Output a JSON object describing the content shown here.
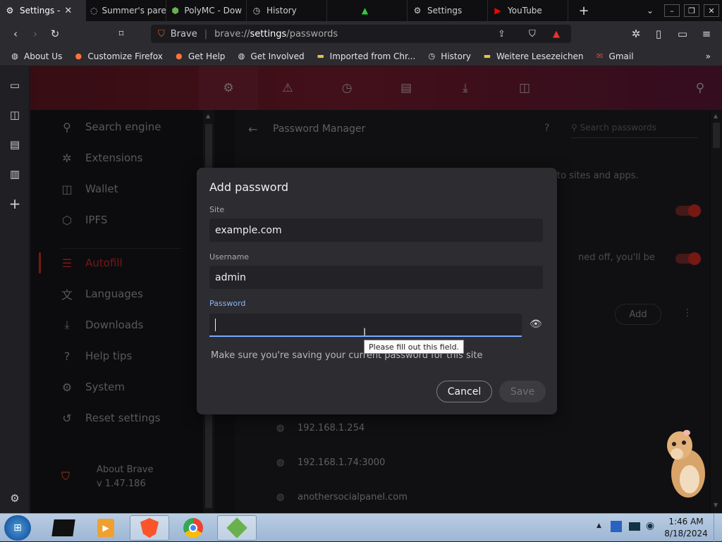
{
  "tabs": [
    {
      "label": "Settings - ",
      "icon": "gear-icon",
      "active": true
    },
    {
      "label": "Summer's pare",
      "icon": "page-icon",
      "active": false
    },
    {
      "label": "PolyMC - Dow",
      "icon": "polymc-icon",
      "active": false
    },
    {
      "label": "History",
      "icon": "history-icon",
      "active": false
    },
    {
      "label": "",
      "icon": "brave-leaf-icon",
      "active": false
    },
    {
      "label": "Settings",
      "icon": "gear-icon",
      "active": false
    },
    {
      "label": "YouTube",
      "icon": "youtube-icon",
      "active": false
    }
  ],
  "toolbar": {
    "site_name": "Brave",
    "url_prefix": "brave://",
    "url_bold": "settings",
    "url_suffix": "/passwords"
  },
  "bookmarks": [
    {
      "label": "About Us",
      "icon": "globe-icon"
    },
    {
      "label": "Customize Firefox",
      "icon": "firefox-icon"
    },
    {
      "label": "Get Help",
      "icon": "firefox-icon"
    },
    {
      "label": "Get Involved",
      "icon": "globe-icon"
    },
    {
      "label": "Imported from Chr...",
      "icon": "folder-icon"
    },
    {
      "label": "History",
      "icon": "history-icon"
    },
    {
      "label": "Weitere Lesezeichen",
      "icon": "folder-icon"
    },
    {
      "label": "Gmail",
      "icon": "gmail-icon"
    }
  ],
  "nav": {
    "items": [
      {
        "label": "Search engine",
        "icon": "search-icon"
      },
      {
        "label": "Extensions",
        "icon": "puzzle-icon"
      },
      {
        "label": "Wallet",
        "icon": "wallet-icon"
      },
      {
        "label": "IPFS",
        "icon": "cube-icon"
      },
      {
        "label": "Autofill",
        "icon": "list-icon",
        "active": true
      },
      {
        "label": "Languages",
        "icon": "translate-icon"
      },
      {
        "label": "Downloads",
        "icon": "download-icon"
      },
      {
        "label": "Help tips",
        "icon": "help-icon"
      },
      {
        "label": "System",
        "icon": "gear-icon"
      },
      {
        "label": "Reset settings",
        "icon": "reset-icon"
      }
    ],
    "about_label": "About Brave",
    "version": "v 1.47.186"
  },
  "main": {
    "title": "Password Manager",
    "search_placeholder": "Search passwords",
    "partial_text_1": "to sites and apps.",
    "partial_text_2": "ned off, you'll be",
    "add_label": "Add",
    "saved_sites": [
      "192.168.1.254",
      "192.168.1.74:3000",
      "anothersocialpanel.com"
    ]
  },
  "dialog": {
    "title": "Add password",
    "site_label": "Site",
    "site_value": "example.com",
    "username_label": "Username",
    "username_value": "admin",
    "password_label": "Password",
    "password_value": "",
    "tooltip": "Please fill out this field.",
    "note": "Make sure you're saving your current password for this site",
    "cancel_label": "Cancel",
    "save_label": "Save"
  },
  "taskbar": {
    "time": "1:46 AM",
    "date": "8/18/2024"
  },
  "colors": {
    "accent_red": "#d0342c",
    "dialog_bg": "#2d2d31",
    "focus_blue": "#7aa7ff",
    "label_blue": "#8ab4f8"
  }
}
